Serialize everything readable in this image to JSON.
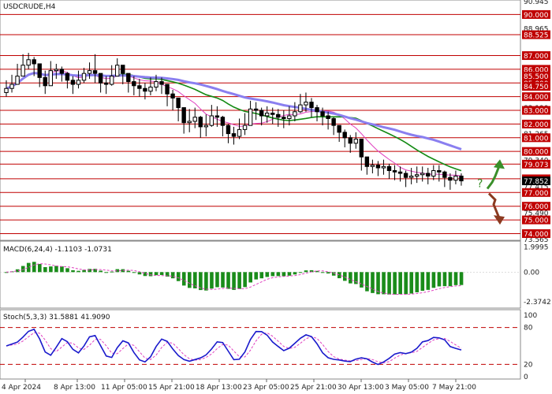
{
  "chart_data": {
    "type": "candlestick",
    "symbol_title": "USDCRUDE,H4",
    "colors": {
      "background": "#ffffff",
      "level_line": "#c00000",
      "candle": "#000000",
      "ma_fast": "#e040c0",
      "ma_mid": "#138a13",
      "ma_slow": "#8a7ff0",
      "macd_hist": "#1a8c1a",
      "macd_signal": "#e040c0",
      "stoch_main": "#1a1acc",
      "stoch_signal": "#e040c0",
      "stoch_levels": "#c00000",
      "price_label_bg": "#c00000",
      "current_label_bg": "#000000",
      "arrow_up": "#3a8f2a",
      "arrow_down": "#8b3a20"
    },
    "price_axis": {
      "ylim": [
        73.565,
        90.945
      ],
      "levels": [
        74.0,
        75.0,
        76.0,
        77.0,
        78.0,
        79.073,
        80.0,
        81.0,
        82.0,
        83.0,
        84.0,
        85.0,
        86.0,
        87.0,
        88.525,
        90.0
      ],
      "level_labels": [
        "74.000",
        "75.000",
        "76.000",
        "77.000",
        "78.000",
        "79.073",
        "80.000",
        "81.000",
        "82.000",
        "83.000",
        "84.000",
        "85.000",
        "86.000",
        "87.000",
        "88.525",
        "90.000"
      ],
      "plain_ticks": [
        73.565,
        75.49,
        77.415,
        79.34,
        81.265,
        83.19,
        85.115,
        87.04,
        88.965,
        90.945
      ],
      "plain_tick_labels": [
        "73.565",
        "75.490",
        "77.415",
        "79.340",
        "81.265",
        "83.190",
        "85.115",
        "87.040",
        "88.965",
        "90.945"
      ],
      "extra_labels": [
        "84.750",
        "85.500"
      ],
      "current_price": 77.852,
      "current_price_label": "77.852"
    },
    "x_axis": {
      "tick_labels": [
        "4 Apr 2024",
        "8 Apr 13:00",
        "11 Apr 05:00",
        "15 Apr 21:00",
        "18 Apr 13:00",
        "23 Apr 05:00",
        "25 Apr 21:00",
        "30 Apr 13:00",
        "3 May 05:00",
        "7 May 21:00"
      ]
    },
    "candles": {
      "closes": [
        84.6,
        84.9,
        85.5,
        86.3,
        86.7,
        86.4,
        85.4,
        84.8,
        85.9,
        86.0,
        85.7,
        85.2,
        84.9,
        85.2,
        85.7,
        85.9,
        85.7,
        85.0,
        84.9,
        85.5,
        86.3,
        85.7,
        85.1,
        84.8,
        84.6,
        84.4,
        84.7,
        85.1,
        84.9,
        84.2,
        83.9,
        83.2,
        82.1,
        82.2,
        82.5,
        81.8,
        81.9,
        82.6,
        82.5,
        81.9,
        81.3,
        81.1,
        81.6,
        81.9,
        83.1,
        83.0,
        82.6,
        82.8,
        82.7,
        82.5,
        82.4,
        82.6,
        82.9,
        83.4,
        83.6,
        83.2,
        82.9,
        82.6,
        82.4,
        81.9,
        81.4,
        81.0,
        80.6,
        80.9,
        79.6,
        78.9,
        79.0,
        78.8,
        78.9,
        78.6,
        78.5,
        78.4,
        78.1,
        78.2,
        78.3,
        78.4,
        78.2,
        78.6,
        78.5,
        78.1,
        77.9,
        78.2,
        77.85
      ],
      "highs": [
        85.2,
        85.6,
        86.4,
        87.1,
        87.2,
        86.9,
        86.0,
        85.9,
        86.6,
        86.4,
        86.2,
        85.8,
        85.5,
        85.9,
        86.1,
        86.5,
        87.1,
        85.6,
        85.5,
        86.3,
        86.8,
        86.2,
        85.6,
        85.5,
        85.3,
        85.0,
        85.4,
        85.6,
        85.4,
        84.7,
        84.5,
        83.9,
        82.9,
        83.1,
        83.2,
        82.6,
        82.7,
        83.4,
        83.3,
        82.6,
        82.0,
        81.8,
        82.4,
        82.8,
        83.7,
        83.6,
        83.2,
        83.3,
        83.2,
        83.1,
        83.0,
        83.3,
        83.6,
        84.2,
        84.3,
        83.9,
        83.4,
        83.2,
        82.9,
        82.5,
        81.9,
        81.6,
        81.2,
        81.4,
        80.5,
        79.5,
        79.4,
        79.3,
        79.4,
        79.1,
        79.0,
        78.9,
        78.6,
        78.8,
        78.9,
        78.9,
        78.8,
        79.0,
        79.0,
        78.6,
        78.4,
        78.6,
        78.4
      ],
      "lows": [
        84.0,
        84.3,
        84.9,
        85.7,
        86.0,
        85.5,
        84.7,
        84.2,
        85.0,
        85.3,
        85.1,
        84.6,
        84.2,
        84.6,
        85.0,
        85.3,
        85.0,
        84.3,
        84.2,
        84.8,
        85.6,
        84.9,
        84.3,
        84.1,
        84.0,
        83.8,
        84.1,
        84.4,
        84.2,
        83.3,
        83.0,
        82.2,
        81.3,
        81.4,
        81.7,
        81.0,
        81.1,
        81.8,
        81.8,
        81.1,
        80.6,
        80.5,
        80.9,
        81.2,
        82.2,
        82.3,
        81.9,
        82.1,
        82.0,
        81.8,
        81.7,
        81.9,
        82.2,
        82.8,
        82.9,
        82.5,
        82.2,
        81.9,
        81.6,
        81.2,
        80.7,
        80.3,
        79.9,
        80.2,
        78.6,
        78.3,
        78.4,
        78.2,
        78.3,
        78.0,
        77.9,
        77.8,
        77.4,
        77.6,
        77.7,
        77.8,
        77.6,
        77.9,
        77.8,
        77.4,
        77.2,
        77.6,
        77.5
      ]
    },
    "macd": {
      "label": "MACD(6,24,4) -1.1103 -1.0731",
      "ylim": [
        -2.75,
        2.35
      ],
      "ticks": [
        1.9995,
        0.0,
        -2.3742
      ],
      "tick_labels": [
        "1.9995",
        "0.00",
        "-2.3742"
      ]
    },
    "stochastic": {
      "label": "Stoch(5,3,3) 31.5881 41.9090",
      "ylim": [
        0,
        100
      ],
      "ticks": [
        100,
        80,
        20,
        0
      ],
      "tick_labels": [
        "100",
        "80",
        "20",
        "0"
      ],
      "overbought": 80,
      "oversold": 20
    },
    "forecast_icon": {
      "symbol": "?",
      "up_target": 79.073,
      "down_target": 75.0
    }
  }
}
